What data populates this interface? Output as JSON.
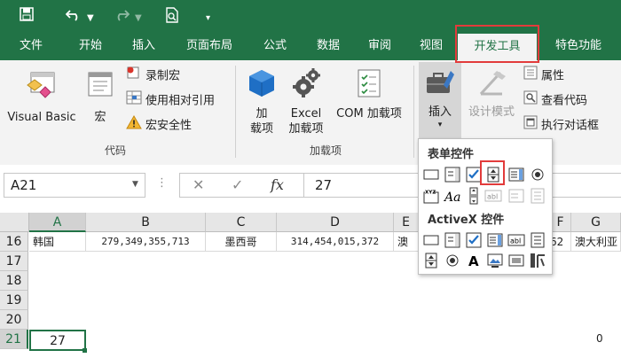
{
  "tabs": {
    "file": "文件",
    "home": "开始",
    "insert": "插入",
    "page_layout": "页面布局",
    "formulas": "公式",
    "data": "数据",
    "review": "审阅",
    "view": "视图",
    "developer": "开发工具",
    "special": "特色功能"
  },
  "ribbon": {
    "code": {
      "visual_basic": "Visual Basic",
      "macros": "宏",
      "record_macro": "录制宏",
      "relative_ref": "使用相对引用",
      "macro_security": "宏安全性",
      "label": "代码"
    },
    "addins": {
      "addins_line1": "加",
      "addins_line2": "载项",
      "excel_line1": "Excel",
      "excel_line2": "加载项",
      "com": "COM 加载项",
      "label": "加载项"
    },
    "controls": {
      "insert": "插入",
      "design_mode": "设计模式",
      "properties": "属性",
      "view_code": "查看代码",
      "run_dialog": "执行对话框"
    }
  },
  "gallery": {
    "form_controls": "表单控件",
    "activex_controls": "ActiveX 控件"
  },
  "formula_bar": {
    "name_box": "A21",
    "cancel": "✕",
    "enter": "✓",
    "fx": "fx",
    "value": "27"
  },
  "grid": {
    "columns": [
      "A",
      "B",
      "C",
      "D",
      "E",
      "F",
      "G"
    ],
    "rows": [
      "16",
      "17",
      "18",
      "19",
      "20",
      "21"
    ],
    "row16": [
      "韩国",
      "279,349,355,713",
      "墨西哥",
      "314,454,015,372",
      "澳",
      "62",
      "澳大利亚"
    ],
    "row21": [
      "27",
      "0"
    ]
  },
  "colors": {
    "excel_green": "#217346",
    "highlight_red": "#e23b3b"
  }
}
